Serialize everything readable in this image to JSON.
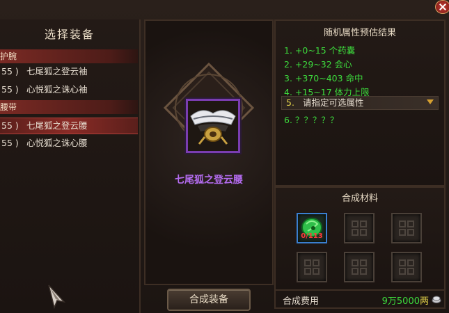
{
  "left": {
    "title": "选择装备",
    "categories": [
      {
        "label": "护腕"
      },
      {
        "label": "腰带"
      }
    ],
    "items": [
      {
        "level": "55 )",
        "name": "七尾狐之登云袖"
      },
      {
        "level": "55 )",
        "name": "心悦狐之诛心袖"
      },
      {
        "level": "55 )",
        "name": "七尾狐之登云腰"
      },
      {
        "level": "55 )",
        "name": "心悦狐之诛心腰"
      }
    ]
  },
  "center": {
    "item_name": "七尾狐之登云腰",
    "synth_label": "合成装备"
  },
  "attrs": {
    "title": "随机属性预估结果",
    "lines": [
      "1. +0~15 个药囊",
      "2. +29~32 会心",
      "3. +370~403 命中",
      "4. +15~17 体力上限"
    ],
    "select_num": "5.",
    "select_text": "请指定可选属性",
    "line6": "6. ？？？？？"
  },
  "materials": {
    "title": "合成材料",
    "count": "0/113",
    "cost_label": "合成费用",
    "cost_value": "9万5000",
    "cost_unit": "两"
  },
  "colors": {
    "selected_row": "#8a2b26",
    "attr_green": "#3ddc3d",
    "item_purple": "#b46cf0",
    "count_red": "#ff3a3a"
  }
}
